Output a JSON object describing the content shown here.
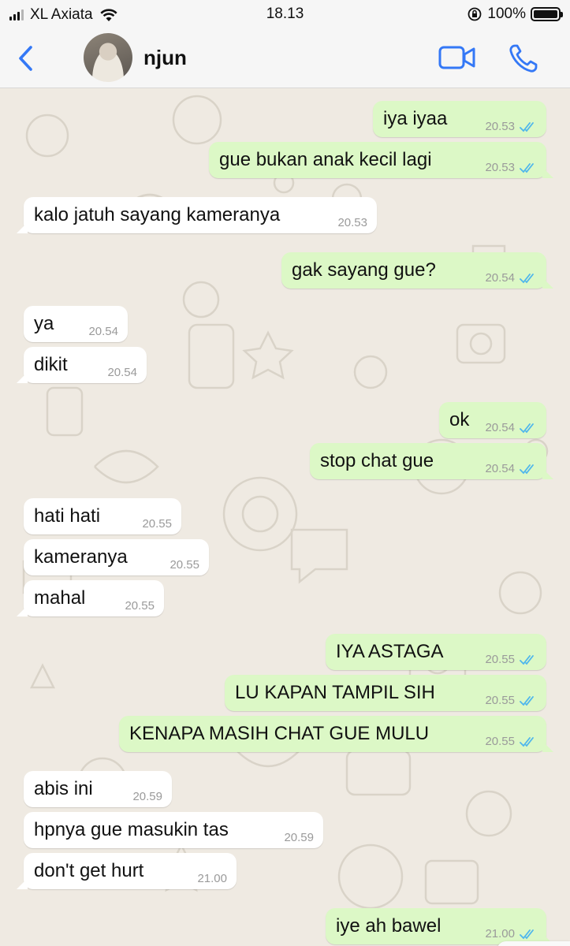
{
  "status_bar": {
    "carrier": "XL Axiata",
    "time": "18.13",
    "battery": "100%",
    "signal_bars": 3,
    "battery_level": 1.0
  },
  "header": {
    "contact_name": "njun",
    "icons": [
      "chevron-left-icon",
      "avatar",
      "video-camera-icon",
      "phone-icon"
    ],
    "accent_color": "#3478f6"
  },
  "colors": {
    "incoming_bubble": "#ffffff",
    "outgoing_bubble": "#dcf8c6",
    "read_ticks": "#4fb6ec",
    "wallpaper": "#efeae2"
  },
  "messages": [
    {
      "dir": "out",
      "text": "iya iyaa",
      "time": "20.53"
    },
    {
      "dir": "out",
      "text": "gue bukan anak kecil lagi",
      "time": "20.53"
    },
    {
      "dir": "in",
      "text": "kalo jatuh sayang kameranya",
      "time": "20.53"
    },
    {
      "dir": "out",
      "text": "gak sayang gue?",
      "time": "20.54"
    },
    {
      "dir": "in",
      "text": "ya",
      "time": "20.54"
    },
    {
      "dir": "in",
      "text": "dikit",
      "time": "20.54"
    },
    {
      "dir": "out",
      "text": "ok",
      "time": "20.54"
    },
    {
      "dir": "out",
      "text": "stop chat gue",
      "time": "20.54"
    },
    {
      "dir": "in",
      "text": "hati hati",
      "time": "20.55"
    },
    {
      "dir": "in",
      "text": "kameranya",
      "time": "20.55"
    },
    {
      "dir": "in",
      "text": "mahal",
      "time": "20.55"
    },
    {
      "dir": "out",
      "text": "IYA ASTAGA",
      "time": "20.55"
    },
    {
      "dir": "out",
      "text": "LU KAPAN TAMPIL SIH",
      "time": "20.55"
    },
    {
      "dir": "out",
      "text": "KENAPA MASIH CHAT GUE MULU",
      "time": "20.55"
    },
    {
      "dir": "in",
      "text": "abis ini",
      "time": "20.59"
    },
    {
      "dir": "in",
      "text": "hpnya gue masukin tas",
      "time": "20.59"
    },
    {
      "dir": "in",
      "text": "don't get hurt",
      "time": "21.00"
    },
    {
      "dir": "out",
      "text": "iye ah bawel",
      "time": "21.00"
    }
  ]
}
